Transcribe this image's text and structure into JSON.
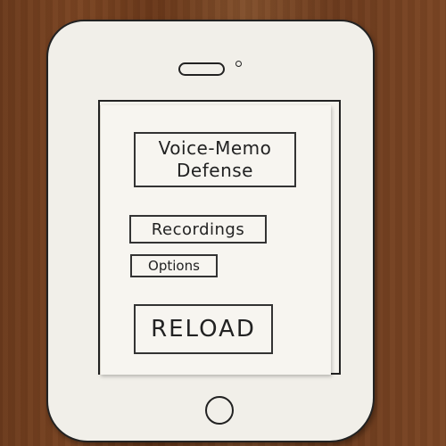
{
  "app": {
    "title": "Voice-Memo Defense"
  },
  "menu": {
    "recordings_label": "Recordings",
    "options_label": "Options",
    "reload_label": "RELOAD"
  },
  "colors": {
    "table_wood": "#6f3d1e",
    "paper": "#f3f1eb",
    "ink": "#222222"
  }
}
